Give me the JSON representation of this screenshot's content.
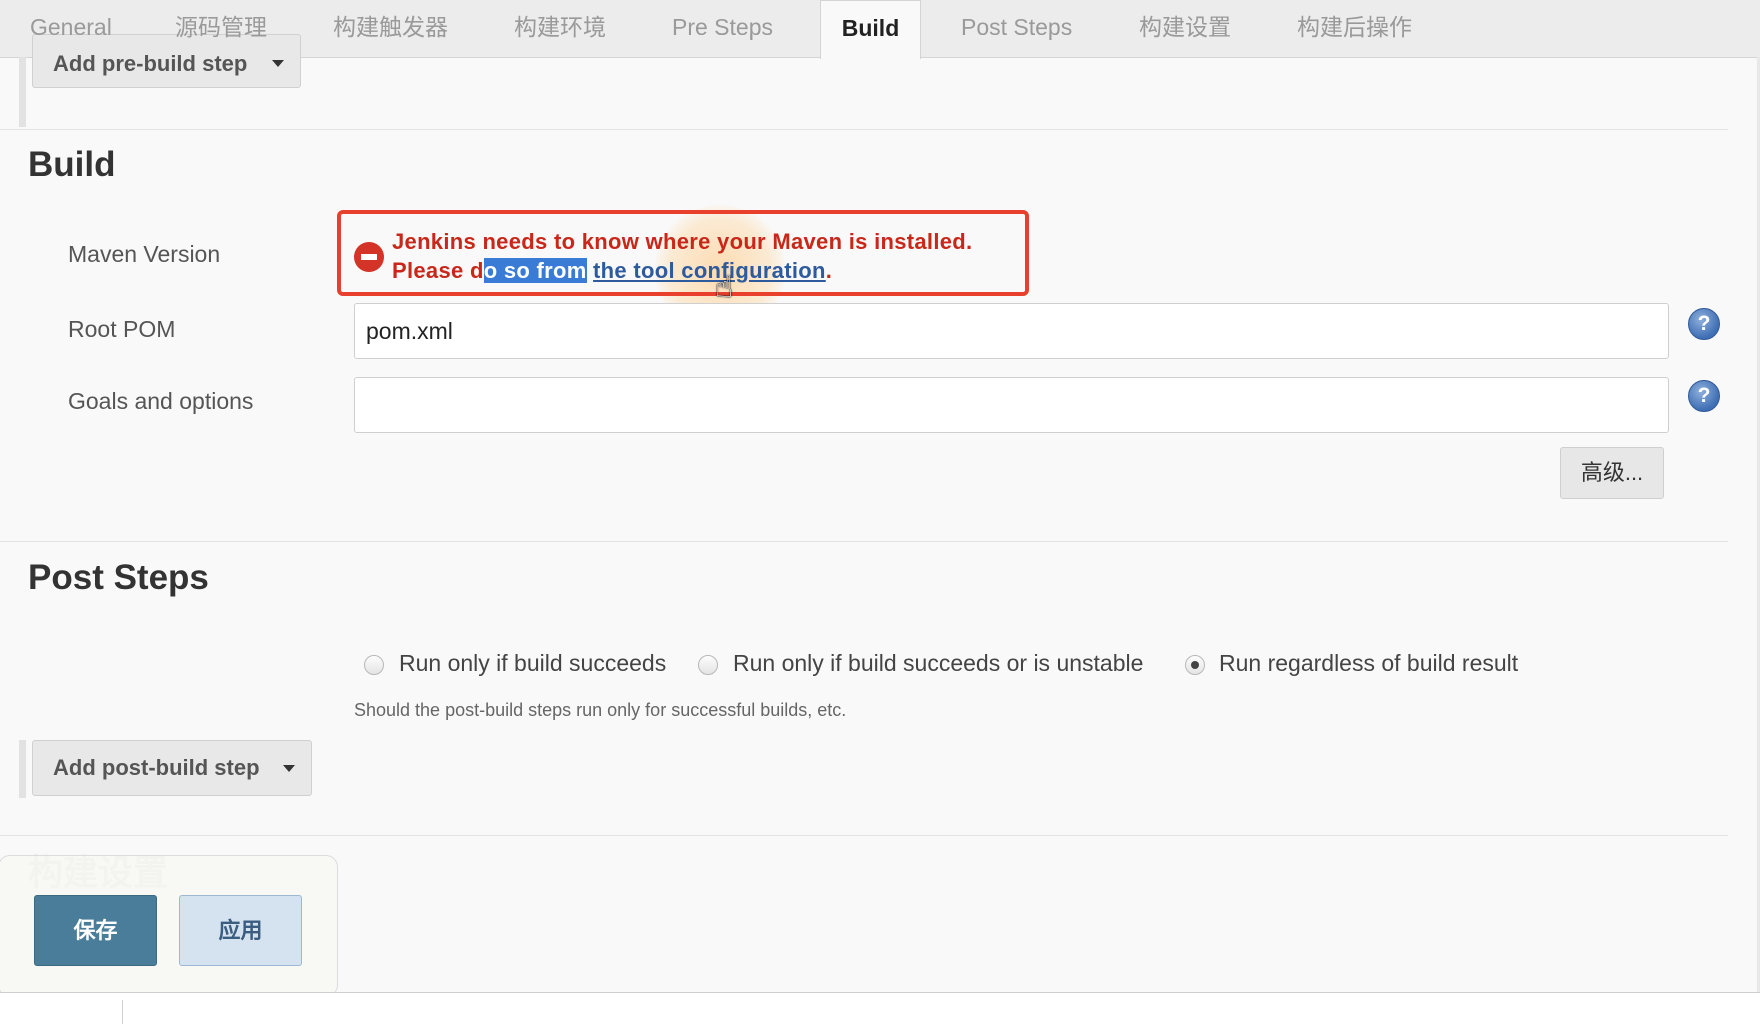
{
  "tabs": [
    {
      "label": "General"
    },
    {
      "label": "源码管理"
    },
    {
      "label": "构建触发器"
    },
    {
      "label": "构建环境"
    },
    {
      "label": "Pre Steps"
    },
    {
      "label": "Build"
    },
    {
      "label": "Post Steps"
    },
    {
      "label": "构建设置"
    },
    {
      "label": "构建后操作"
    }
  ],
  "pre_steps": {
    "add_button_label": "Add pre-build step"
  },
  "build": {
    "title": "Build",
    "maven_version_label": "Maven Version",
    "error": {
      "line1": "Jenkins needs to know where your Maven is installed.",
      "line2_prefix": "Please d",
      "line2_selected": "o so from",
      "line2_space": " ",
      "link_text": "the tool configuration",
      "line2_suffix": "."
    },
    "root_pom_label": "Root POM",
    "root_pom_value": "pom.xml",
    "goals_label": "Goals and options",
    "goals_value": "",
    "advanced_button": "高级...",
    "help_glyph": "?"
  },
  "post_steps": {
    "title": "Post Steps",
    "options": [
      {
        "label": "Run only if build succeeds",
        "checked": false
      },
      {
        "label": "Run only if build succeeds or is unstable",
        "checked": false
      },
      {
        "label": "Run regardless of build result",
        "checked": true
      }
    ],
    "hint": "Should the post-build steps run only for successful builds, etc.",
    "add_button_label": "Add post-build step"
  },
  "build_settings": {
    "title": "构建设置"
  },
  "actions": {
    "save_label": "保存",
    "apply_label": "应用"
  },
  "colors": {
    "error_border": "#e8402d",
    "error_text": "#c9271a",
    "link": "#2e5a9e",
    "save_bg": "#4a7d99",
    "apply_bg": "#d5e3f1",
    "selection": "#3a7bd5"
  }
}
